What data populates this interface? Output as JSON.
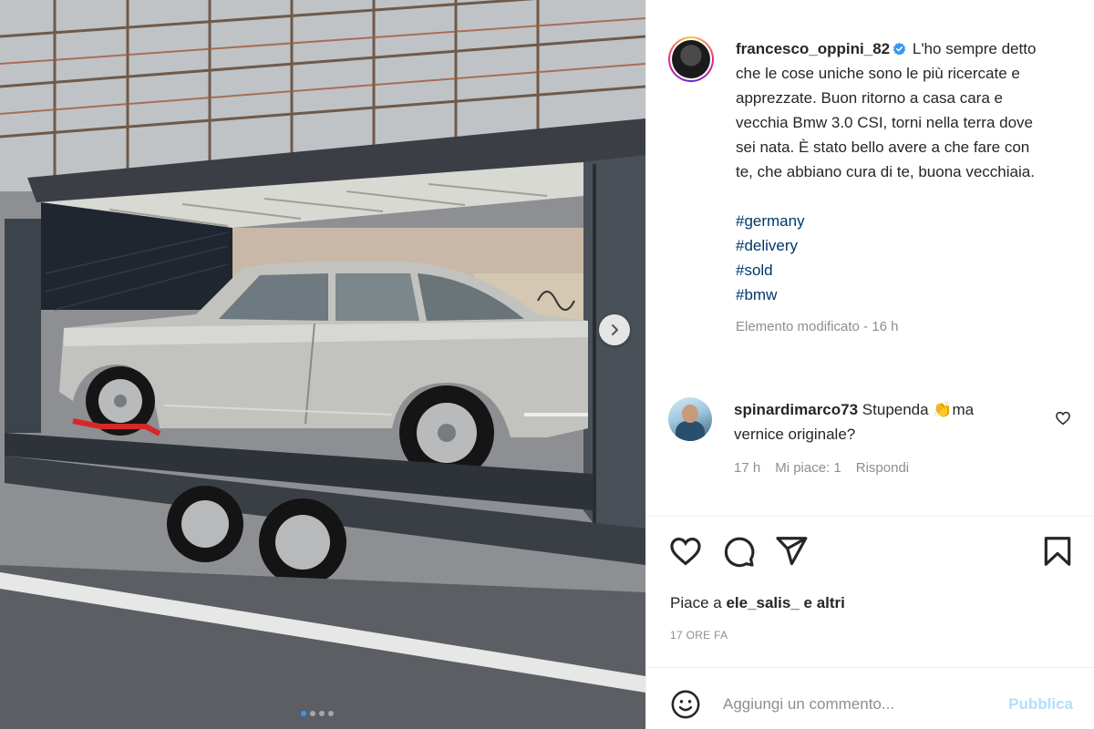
{
  "post": {
    "username": "francesco_oppini_82",
    "caption": "L'ho sempre detto che le cose uniche sono le più ricercate e apprezzate. Buon ritorno a casa cara e vecchia Bmw 3.0 CSI, torni nella terra dove sei nata. È stato bello avere a che fare con te, che abbiano cura di te, buona vecchiaia.",
    "hashtags": [
      "#germany",
      "#delivery",
      "#sold",
      "#bmw"
    ],
    "edited": "Elemento modificato - 16 h",
    "verified_color": "#3897f0"
  },
  "comment": {
    "username": "spinardimarco73",
    "text_before": "Stupenda ",
    "emoji": "👏",
    "text_after": "ma vernice originale?",
    "time": "17 h",
    "likes": "Mi piace: 1",
    "reply": "Rispondi"
  },
  "actions": {
    "like_icon": "heart-icon",
    "comment_icon": "comment-icon",
    "share_icon": "send-icon",
    "save_icon": "bookmark-icon"
  },
  "likes": {
    "prefix": "Piace a",
    "user": "ele_salis_",
    "suffix": "e altri"
  },
  "timestamp": "17 ORE FA",
  "composer": {
    "placeholder": "Aggiungi un commento...",
    "publish": "Pubblica"
  },
  "carousel": {
    "count": 4,
    "active_index": 0
  }
}
